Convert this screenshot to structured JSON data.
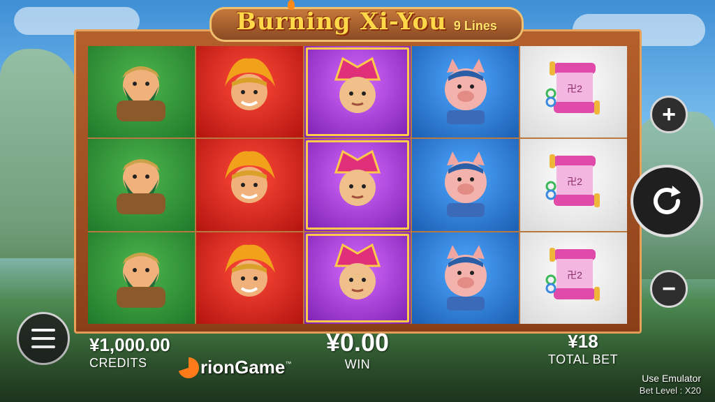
{
  "game": {
    "title": "Burning Xi-You",
    "lines_badge": "9 Lines"
  },
  "reels": [
    [
      "warrior",
      "monkey",
      "monk",
      "pig",
      "scroll"
    ],
    [
      "warrior",
      "monkey",
      "monk",
      "pig",
      "scroll"
    ],
    [
      "warrior",
      "monkey",
      "monk",
      "pig",
      "scroll"
    ]
  ],
  "reel_colors": [
    "green",
    "red",
    "purple",
    "blue",
    "white"
  ],
  "controls": {
    "plus_label": "+",
    "minus_label": "−",
    "spin_label": "↻",
    "menu_label": "☰",
    "spin_hint": "‹"
  },
  "stats": {
    "credits_value": "¥1,000.00",
    "credits_label": "CREDITS",
    "win_value": "¥0.00",
    "win_label": "WIN",
    "total_bet_value": "¥18",
    "total_bet_label": "TOTAL BET"
  },
  "branding": {
    "logo_text": "rionGame",
    "trademark": "™"
  },
  "emulator": {
    "label": "Use Emulator",
    "bet_level_label": "Bet Level",
    "bet_level_value": "X20"
  },
  "colors": {
    "frame": "#b4602c",
    "title": "#ffd84a",
    "brand_orange": "#ff7b1a"
  }
}
